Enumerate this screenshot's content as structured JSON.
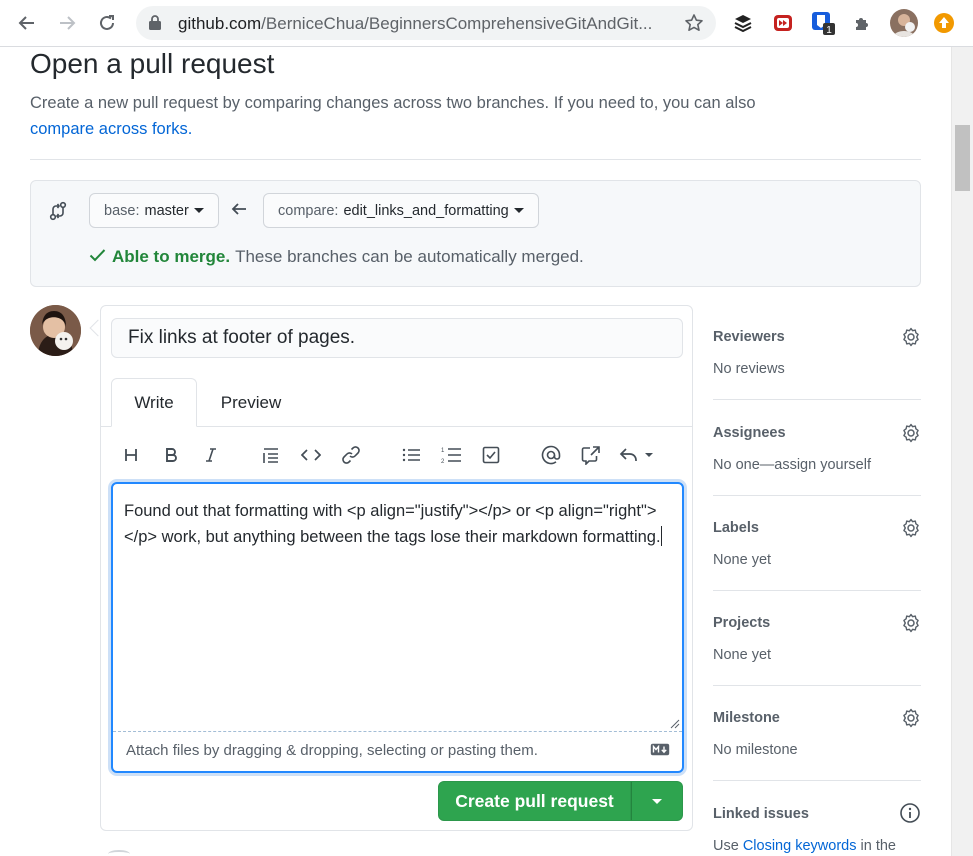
{
  "browser": {
    "url_host": "github.com",
    "url_path": "/BerniceChua/BeginnersComprehensiveGitAndGit...",
    "extension_badge": "1"
  },
  "page": {
    "title": "Open a pull request",
    "subtitle_text": "Create a new pull request by comparing changes across two branches. If you need to, you can also",
    "subtitle_link": "compare across forks."
  },
  "range": {
    "base_prefix": "base:",
    "base_branch": "master",
    "compare_prefix": "compare:",
    "compare_branch": "edit_links_and_formatting",
    "merge_status_strong": "Able to merge.",
    "merge_status_text": "These branches can be automatically merged."
  },
  "form": {
    "title_value": "Fix links at footer of pages.",
    "tabs": {
      "write": "Write",
      "preview": "Preview"
    },
    "toolbar": [
      "header",
      "bold",
      "italic",
      "quote",
      "code",
      "link",
      "bulleted-list",
      "numbered-list",
      "task-list",
      "mention",
      "cross-reference",
      "reply"
    ],
    "body_value": "Found out that formatting with <p align=\"justify\"></p> or <p align=\"right\"></p> work, but anything between the tags lose their markdown formatting.",
    "drop_hint": "Attach files by dragging & dropping, selecting or pasting them.",
    "submit_label": "Create pull request"
  },
  "sidebar": {
    "reviewers": {
      "heading": "Reviewers",
      "value": "No reviews"
    },
    "assignees": {
      "heading": "Assignees",
      "value": "No one—assign yourself"
    },
    "labels": {
      "heading": "Labels",
      "value": "None yet"
    },
    "projects": {
      "heading": "Projects",
      "value": "None yet"
    },
    "milestone": {
      "heading": "Milestone",
      "value": "No milestone"
    },
    "linked_issues": {
      "heading": "Linked issues",
      "value_prefix": "Use",
      "value_link": "Closing keywords",
      "value_suffix": "in the"
    }
  },
  "colors": {
    "accent_link": "#0366d6",
    "success_green": "#2ea44f",
    "merge_green": "#22863a",
    "focus_blue": "#2188ff"
  }
}
